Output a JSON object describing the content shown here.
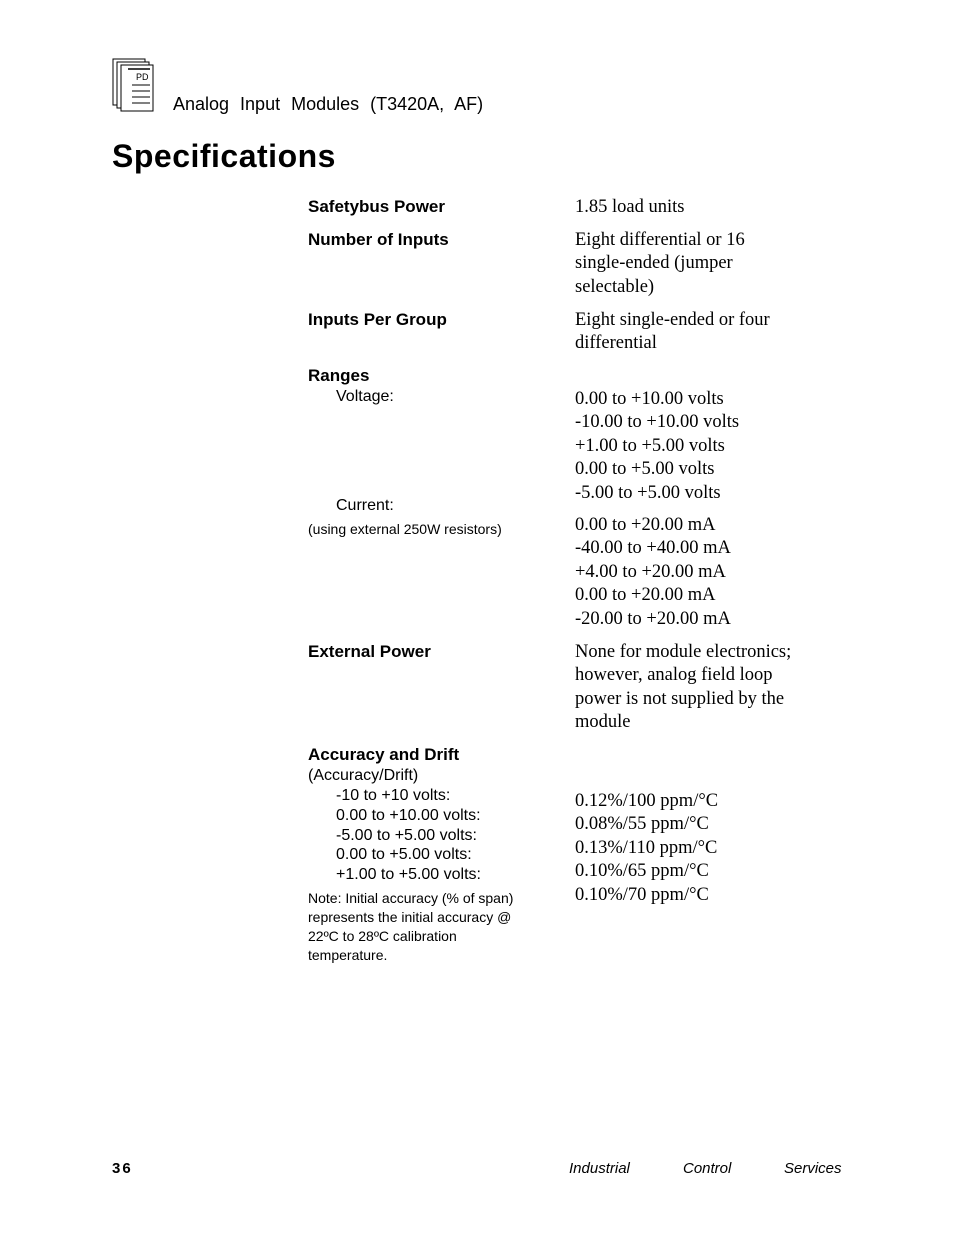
{
  "header": {
    "logo_icon": "pd-document-stack-icon",
    "logo_text": "PD",
    "subtitle": "Analog Input Modules (T3420A, AF)"
  },
  "title": "Specifications",
  "specs": {
    "safetybus_power": {
      "label": "Safetybus Power",
      "value": "1.85 load units"
    },
    "number_of_inputs": {
      "label": "Number of Inputs",
      "value_lines": [
        "Eight differential or 16",
        "single-ended (jumper",
        "selectable)"
      ]
    },
    "inputs_per_group": {
      "label": "Inputs Per Group",
      "value_lines": [
        "Eight single-ended or four",
        "differential"
      ]
    },
    "ranges": {
      "label": "Ranges",
      "voltage_label": "Voltage:",
      "voltage_values": [
        "0.00 to +10.00 volts",
        "-10.00 to +10.00 volts",
        "+1.00 to +5.00 volts",
        "0.00 to +5.00 volts",
        "-5.00 to +5.00 volts"
      ],
      "current_label": "Current:",
      "current_note": "(using external 250W resistors)",
      "current_values": [
        "0.00 to +20.00 mA",
        "-40.00 to +40.00 mA",
        "+4.00 to +20.00 mA",
        "0.00 to +20.00 mA",
        "-20.00 to +20.00 mA"
      ]
    },
    "external_power": {
      "label": "External Power",
      "value_lines": [
        "None for module electronics;",
        "however, analog field loop",
        "power is not supplied by the",
        "module"
      ]
    },
    "accuracy_drift": {
      "label": "Accuracy and Drift",
      "sublabel": "(Accuracy/Drift)",
      "rows": [
        {
          "range": "-10 to +10 volts:",
          "value": "0.12%/100 ppm/°C"
        },
        {
          "range": "0.00 to +10.00 volts:",
          "value": "0.08%/55 ppm/°C"
        },
        {
          "range": "-5.00 to +5.00 volts:",
          "value": "0.13%/110 ppm/°C"
        },
        {
          "range": "0.00 to +5.00 volts:",
          "value": "0.10%/65 ppm/°C"
        },
        {
          "range": "+1.00 to +5.00 volts:",
          "value": "0.10%/70 ppm/°C"
        }
      ],
      "note_lines": [
        "Note:  Initial accuracy (% of span)",
        "represents the initial accuracy @",
        "22ºC to 28ºC calibration",
        "temperature."
      ]
    }
  },
  "footer": {
    "page_number": "36",
    "words": [
      "Industrial",
      "Control",
      "Services"
    ]
  }
}
